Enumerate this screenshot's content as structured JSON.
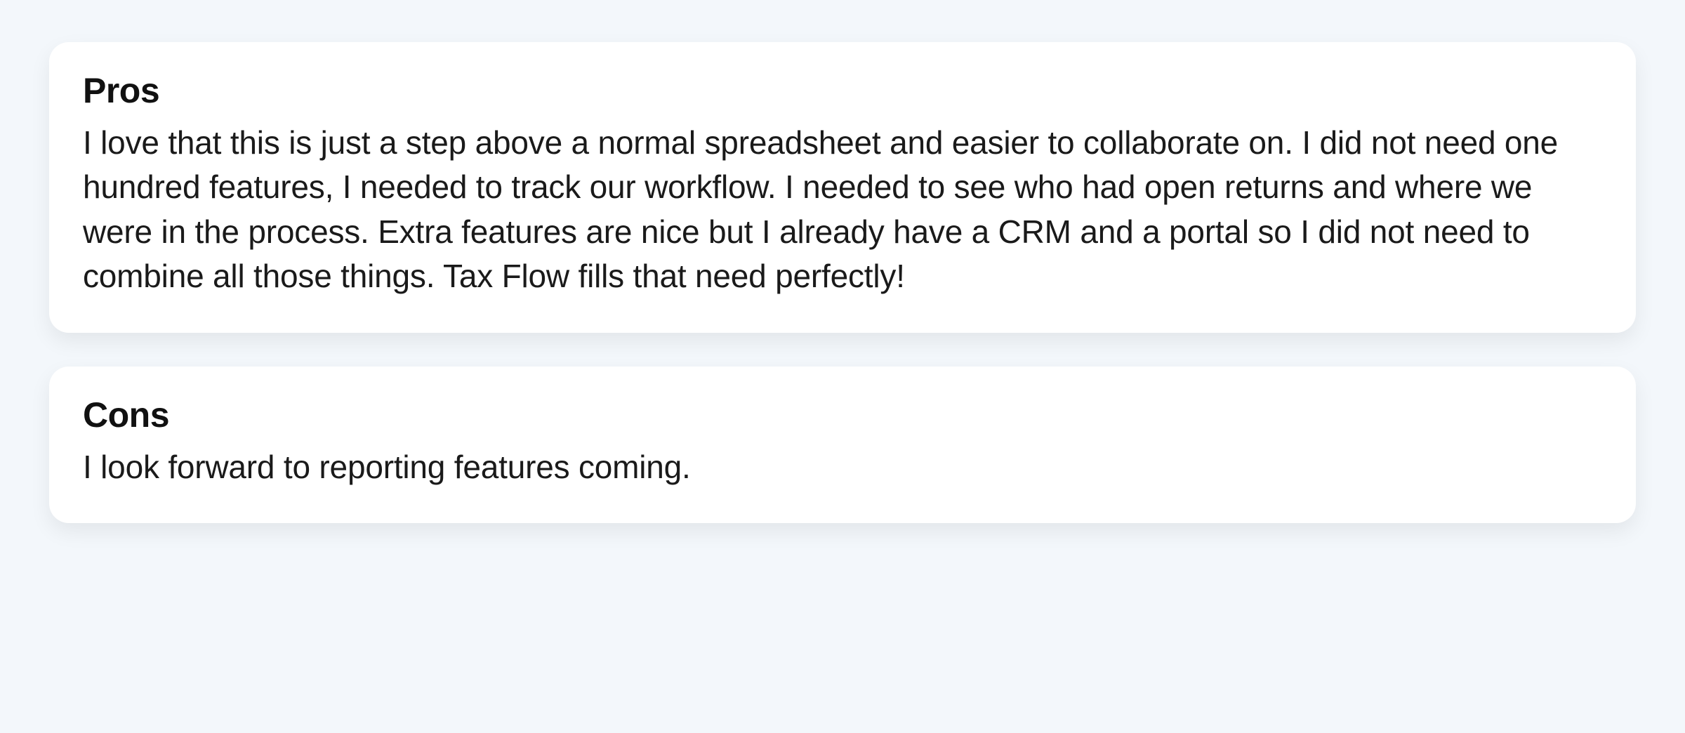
{
  "cards": [
    {
      "title": "Pros",
      "body": "I love that this is just a step above a normal spreadsheet and easier to collaborate on. I did not need one hundred features, I needed to track our workflow. I needed to see who had open returns and where we were in the process. Extra features are nice but I already have a CRM and a portal so I did not need to combine all those things. Tax Flow fills that need perfectly!"
    },
    {
      "title": "Cons",
      "body": "I look forward to reporting features coming."
    }
  ]
}
